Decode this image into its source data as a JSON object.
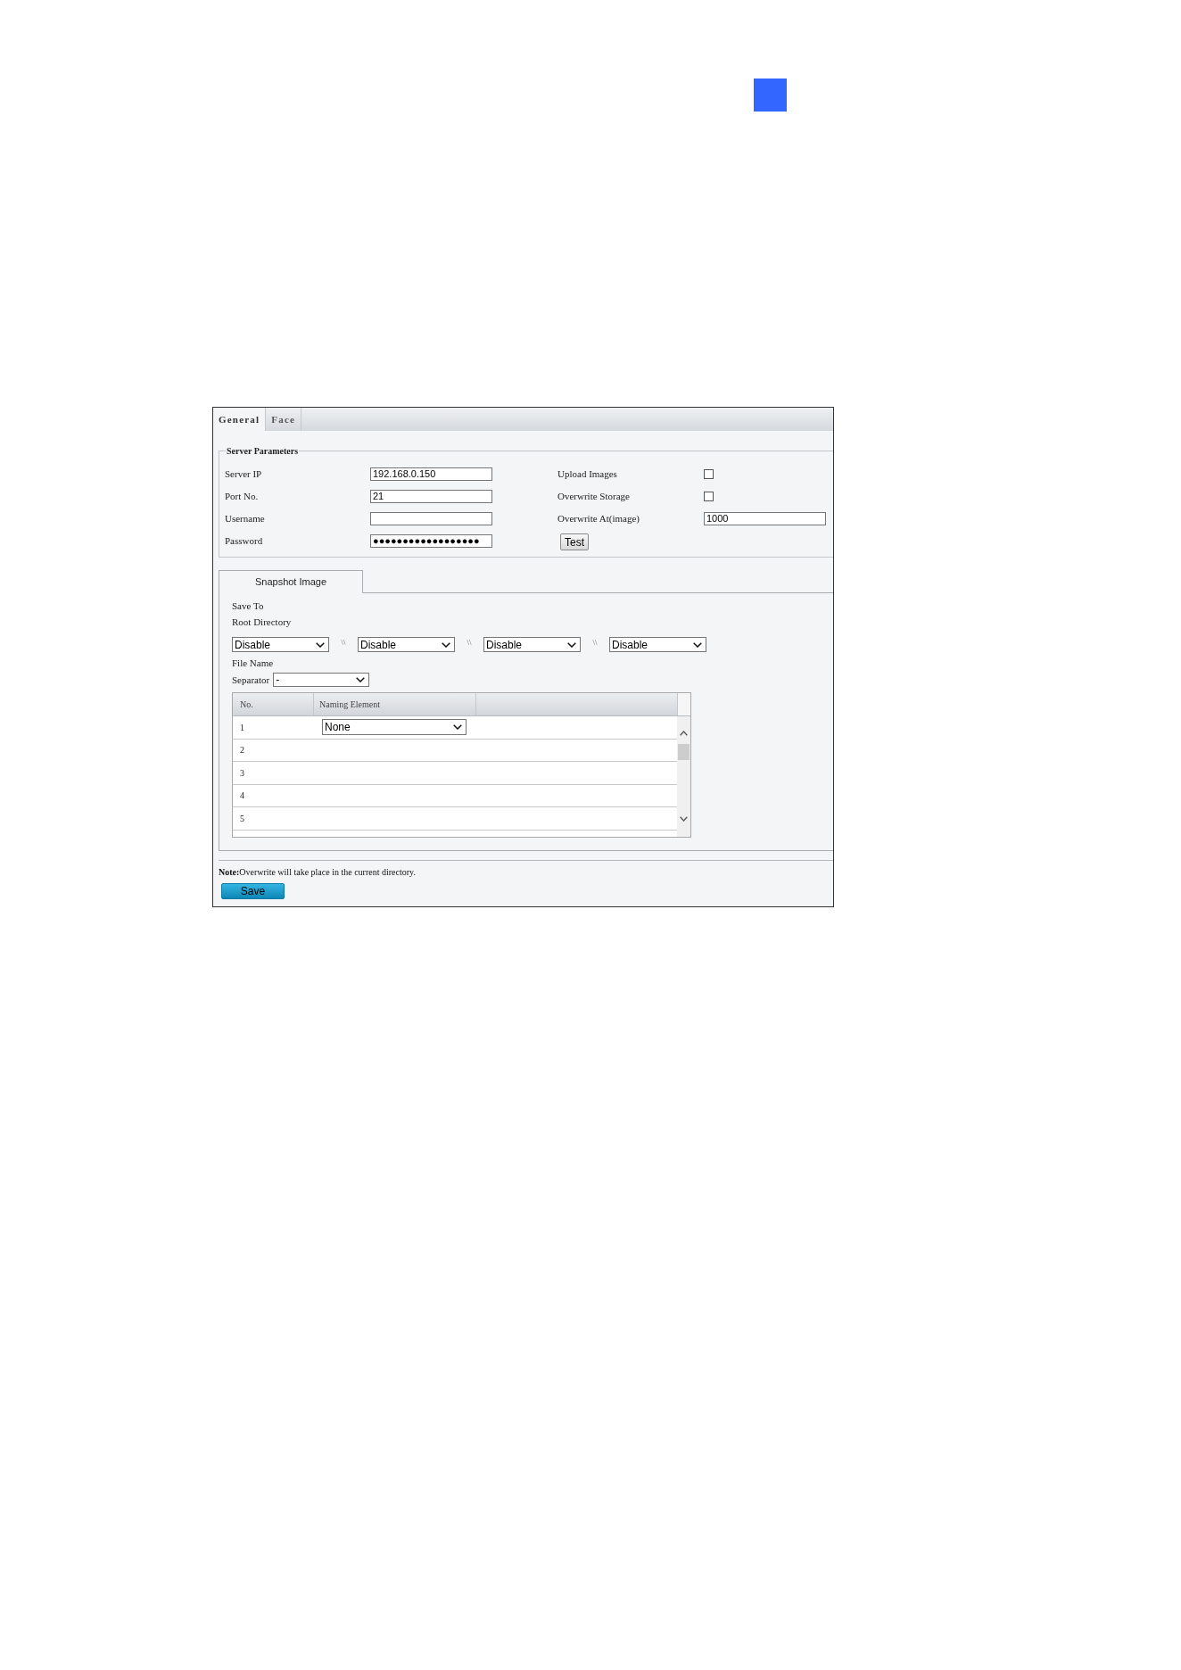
{
  "tabs": [
    {
      "label": "General",
      "selected": true
    },
    {
      "label": "Face",
      "selected": false
    }
  ],
  "server_parameters": {
    "legend": "Server Parameters",
    "fields": [
      {
        "label": "Server IP",
        "value": "192.168.0.150"
      },
      {
        "label": "Port No.",
        "value": "21"
      },
      {
        "label": "Username"
      },
      {
        "label": "Password",
        "value": "●●●●●●●●●●●●●●●●●●"
      }
    ],
    "options": [
      {
        "kind": "checkbox",
        "label": "Upload Images",
        "checked": false
      },
      {
        "kind": "checkbox",
        "label": "Overwrite Storage",
        "checked": false
      },
      {
        "kind": "input",
        "label": "Overwrite At(image)",
        "value": "1000"
      },
      {
        "kind": "button",
        "label": "Test"
      }
    ]
  },
  "snapshot": {
    "tabs": [
      {
        "label": "Snapshot Image",
        "selected": true
      }
    ],
    "save_to": "Save To",
    "root_directory": {
      "label": "Root Directory",
      "selects": [
        "Disable",
        "Disable",
        "Disable",
        "Disable"
      ],
      "separators": [
        "\\\\",
        "\\\\",
        "\\\\"
      ]
    },
    "file_name": "File Name",
    "separator": {
      "label": "Separator",
      "value": "-"
    },
    "table": {
      "columns": [
        "No.",
        "Naming Element"
      ],
      "rows": [
        {
          "no": "1",
          "naming_element": "None"
        },
        {
          "no": "2"
        },
        {
          "no": "3"
        },
        {
          "no": "4"
        },
        {
          "no": "5"
        }
      ]
    }
  },
  "note": "**Note:**Overwrite will take place in the current directory.",
  "save_button": "Save"
}
